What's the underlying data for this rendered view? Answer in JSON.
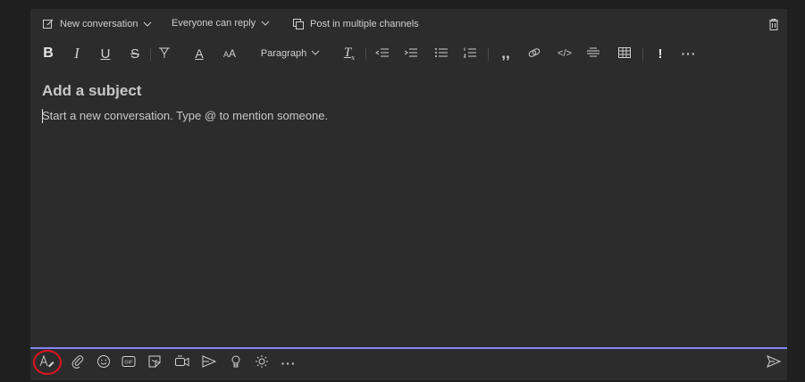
{
  "compose_header": {
    "new_conversation_label": "New conversation",
    "reply_setting_label": "Everyone can reply",
    "post_multiple_label": "Post in multiple channels"
  },
  "format_toolbar": {
    "paragraph_label": "Paragraph"
  },
  "editor": {
    "subject_placeholder": "Add a subject",
    "body_placeholder": "Start a new conversation. Type @ to mention someone."
  },
  "colors": {
    "accent": "#7f85f5",
    "highlight_ring": "#e0141e",
    "background": "#2d2c2c"
  },
  "icons": {
    "top": [
      "compose-icon",
      "chevron-down-icon",
      "copy-channels-icon",
      "trash-icon"
    ],
    "format": [
      "bold-icon",
      "italic-icon",
      "underline-icon",
      "strikethrough-icon",
      "highlight-icon",
      "font-color-icon",
      "font-size-icon",
      "clear-formatting-icon",
      "decrease-indent-icon",
      "increase-indent-icon",
      "bulleted-list-icon",
      "numbered-list-icon",
      "quote-icon",
      "link-icon",
      "code-icon",
      "horizontal-rule-icon",
      "table-icon",
      "important-icon",
      "more-options-icon"
    ],
    "bottom": [
      "format-icon",
      "attach-icon",
      "emoji-icon",
      "gif-icon",
      "sticker-icon",
      "meet-now-icon",
      "stream-icon",
      "praise-icon",
      "updates-icon",
      "more-apps-icon",
      "send-icon"
    ]
  }
}
